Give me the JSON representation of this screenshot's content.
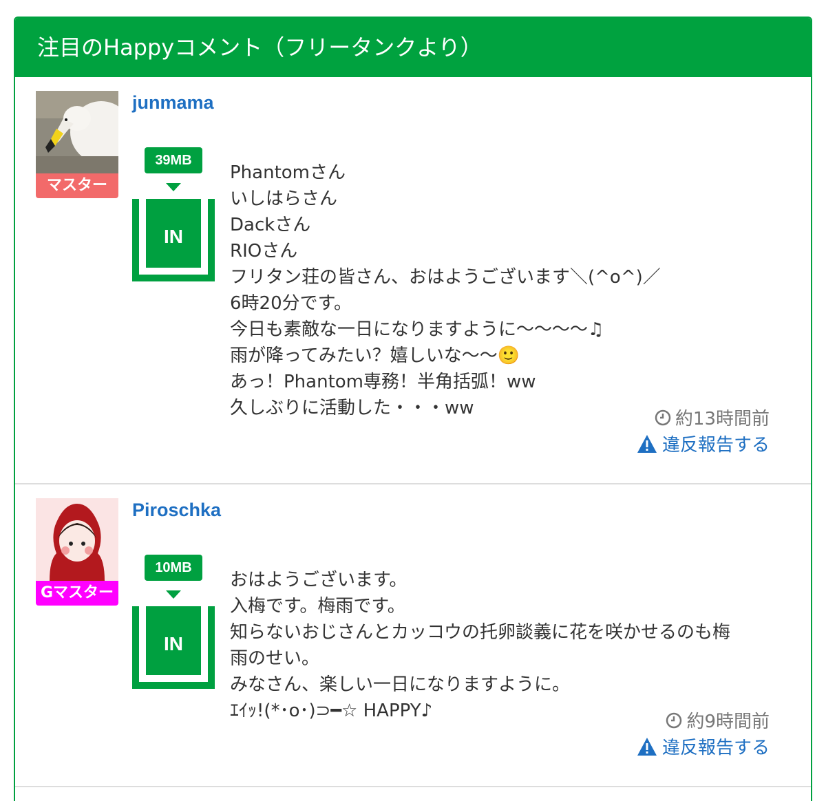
{
  "panel": {
    "title": "注目のHappyコメント（フリータンクより）"
  },
  "comments": [
    {
      "username": "junmama",
      "rank": "マスター",
      "rank_color": "#f26a6a",
      "mb": "39MB",
      "in_label": "IN",
      "message": "Phantomさん\nいしはらさん\nDackさん\nRIOさん\nフリタン荘の皆さん、おはようございます＼(^o^)／\n6時20分です。\n今日も素敵な一日になりますように〜〜〜〜♫\n雨が降ってみたい？嬉しいな〜〜🙂\nあっ！Phantom専務！半角括弧！ww\n久しぶりに活動した・・・ww",
      "time": "約13時間前",
      "report": "違反報告する"
    },
    {
      "username": "Piroschka",
      "rank": "Gマスター",
      "rank_color": "#ff00ff",
      "mb": "10MB",
      "in_label": "IN",
      "message": "おはようございます。\n入梅です。梅雨です。\n知らないおじさんとカッコウの托卵談義に花を咲かせるのも梅\n雨のせい。\nみなさん、楽しい一日になりますように。\nｴｲｯ!(*･o･)⊃━☆ HAPPY♪",
      "time": "約9時間前",
      "report": "違反報告する"
    }
  ],
  "colors": {
    "accent": "#00a23f",
    "link": "#1e6fc2"
  }
}
